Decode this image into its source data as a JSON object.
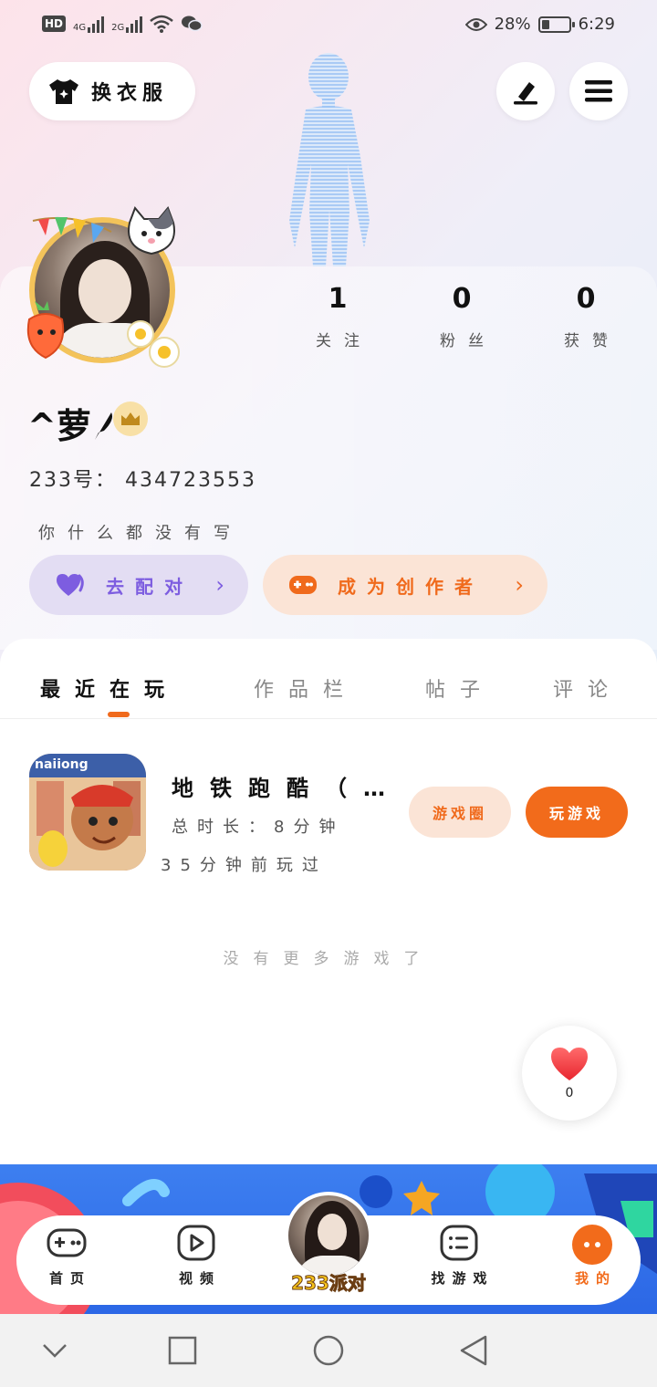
{
  "status_bar": {
    "hd": "HD",
    "net1": "4G",
    "net2": "2G",
    "battery": "28%",
    "time": "6:29"
  },
  "top": {
    "dress_label": "换衣服"
  },
  "profile": {
    "stats": [
      {
        "value": "1",
        "label": "关注"
      },
      {
        "value": "0",
        "label": "粉丝"
      },
      {
        "value": "0",
        "label": "获赞"
      }
    ],
    "nickname": "^萝",
    "uid_label": "233号：",
    "uid_value": "434723553",
    "signature": "你什么都没有写",
    "match_label": "去配对",
    "creator_label": "成为创作者"
  },
  "tabs": [
    {
      "label": "最近在玩",
      "active": true
    },
    {
      "label": "作品栏",
      "active": false
    },
    {
      "label": "帖子",
      "active": false
    },
    {
      "label": "评论",
      "active": false
    }
  ],
  "games": [
    {
      "title": "地铁跑酷（…",
      "icon_text": "naiiong",
      "playtime": "总时长：8分钟",
      "last_played": "35分钟前玩过",
      "circle_label": "游戏圈",
      "play_label": "玩游戏"
    }
  ],
  "empty_text": "没有更多游戏了",
  "like": {
    "count": "0"
  },
  "nav": [
    {
      "label": "首页",
      "icon": "gamepad-icon"
    },
    {
      "label": "视频",
      "icon": "play-icon"
    },
    {
      "label": "233派对",
      "icon": "avatar"
    },
    {
      "label": "找游戏",
      "icon": "list-icon"
    },
    {
      "label": "我的",
      "icon": "me-icon"
    }
  ],
  "colors": {
    "accent": "#f26b1b",
    "purple": "#7d5de0",
    "nav_blue": "#2b66e5"
  }
}
